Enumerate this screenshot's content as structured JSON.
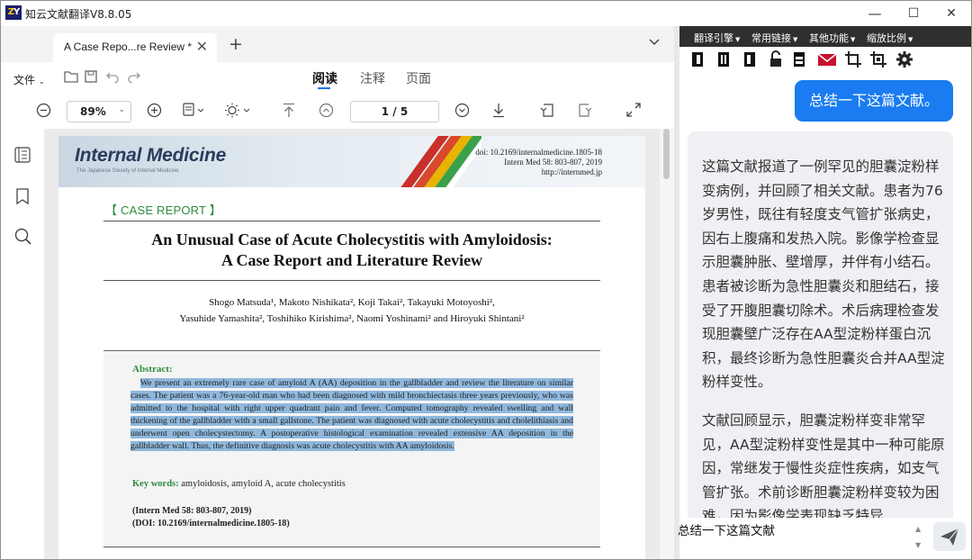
{
  "window": {
    "logo": "ZY",
    "title": "知云文献翻译V8.8.05",
    "minimize": "—",
    "maximize": "☐",
    "close": "✕"
  },
  "tabs": {
    "active_tab": "A Case Repo...re Review *",
    "close": "✕",
    "new_tab": "+",
    "menu": "⌄"
  },
  "toolbar1": {
    "file_menu": "文件",
    "modes": [
      "阅读",
      "注释",
      "页面"
    ],
    "active_mode": "阅读"
  },
  "toolbar2": {
    "zoom": "89%",
    "page_indicator": "1 / 5"
  },
  "document": {
    "journal": "Internal Medicine",
    "journal_sub": "The Japanese Society of Internal Medicine",
    "doi_line": "doi: 10.2169/internalmedicine.1805-18",
    "vol_line": "Intern Med 58: 803-807, 2019",
    "url_line": "http://internmed.jp",
    "case_label": "【 CASE REPORT 】",
    "title_line1": "An Unusual Case of Acute Cholecystitis with Amyloidosis:",
    "title_line2": "A Case Report and Literature Review",
    "authors_line1": "Shogo Matsuda¹, Makoto Nishikata², Koji Takai², Takayuki Motoyoshi²,",
    "authors_line2": "Yasuhide Yamashita², Toshihiko Kirishima², Naomi Yoshinami² and Hiroyuki Shintani²",
    "abstract_heading": "Abstract:",
    "abstract": "We present an extremely rare case of amyloid A (AA) deposition in the gallbladder and review the literature on similar cases. The patient was a 76-year-old man who had been diagnosed with mild bronchiectasis three years previously, who was admitted to the hospital with right upper quadrant pain and fever. Computed tomography revealed swelling and wall thickening of the gallbladder with a small gallstone. The patient was diagnosed with acute cholecystitis and cholelithiasis and underwent open cholecystectomy. A postoperative histological examination revealed extensive AA deposition in the gallbladder wall. Thus, the definitive diagnosis was acute cholecystitis with AA amyloidosis.",
    "keywords_label": "Key words:",
    "keywords": "amyloidosis, amyloid A, acute cholecystitis",
    "citation1": "(Intern Med 58: 803-807, 2019)",
    "citation2": "(DOI: 10.2169/internalmedicine.1805-18)"
  },
  "right_menu": [
    "翻译引擎",
    "常用链接",
    "其他功能",
    "缩放比例"
  ],
  "chat": {
    "user_message": "总结一下这篇文献。",
    "bot_paragraph1": "这篇文献报道了一例罕见的胆囊淀粉样变病例，并回顾了相关文献。患者为76岁男性，既往有轻度支气管扩张病史，因右上腹痛和发热入院。影像学检查显示胆囊肿胀、壁增厚，并伴有小结石。患者被诊断为急性胆囊炎和胆结石，接受了开腹胆囊切除术。术后病理检查发现胆囊壁广泛存在AA型淀粉样蛋白沉积，最终诊断为急性胆囊炎合并AA型淀粉样变性。",
    "bot_paragraph2": "文献回顾显示，胆囊淀粉样变非常罕见，AA型淀粉样变性是其中一种可能原因，常继发于慢性炎症性疾病，如支气管扩张。术前诊断胆囊淀粉样变较为困难，因为影像学表现缺乏特异",
    "input_value": "总结一下这篇文献"
  },
  "colors": {
    "accent": "#1a7cf0",
    "menubar": "#2f2f2f",
    "highlight": "#8fb8dd",
    "green_heading": "#2e8b3e"
  }
}
